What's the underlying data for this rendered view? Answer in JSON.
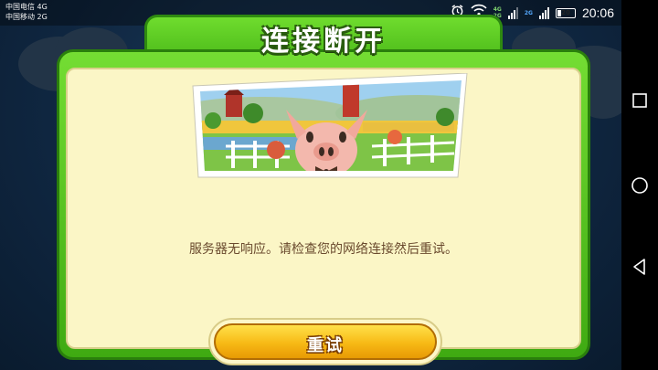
{
  "status_bar": {
    "carrier_1": "中国电信 4G",
    "carrier_2": "中国移动 2G",
    "net_tag_top": "4G",
    "net_tag_bottom": "2G",
    "net_tag_right": "2G",
    "battery_level": "20",
    "time": "20:06",
    "icons": [
      "alarm-icon",
      "wifi-icon",
      "signal-icon",
      "battery-icon"
    ]
  },
  "dialog": {
    "title": "连接断开",
    "message": "服务器无响应。请检查您的网络连接然后重试。",
    "retry_label": "重试",
    "image_description": "farm-pig-illustration"
  },
  "nav": {
    "icons": [
      "recent-apps-icon",
      "home-icon",
      "back-icon"
    ]
  },
  "colors": {
    "frame_green": "#4cbb1a",
    "panel_cream": "#fbf6c6",
    "button_yellow": "#f7b915",
    "message_brown": "#6a4a2e"
  }
}
